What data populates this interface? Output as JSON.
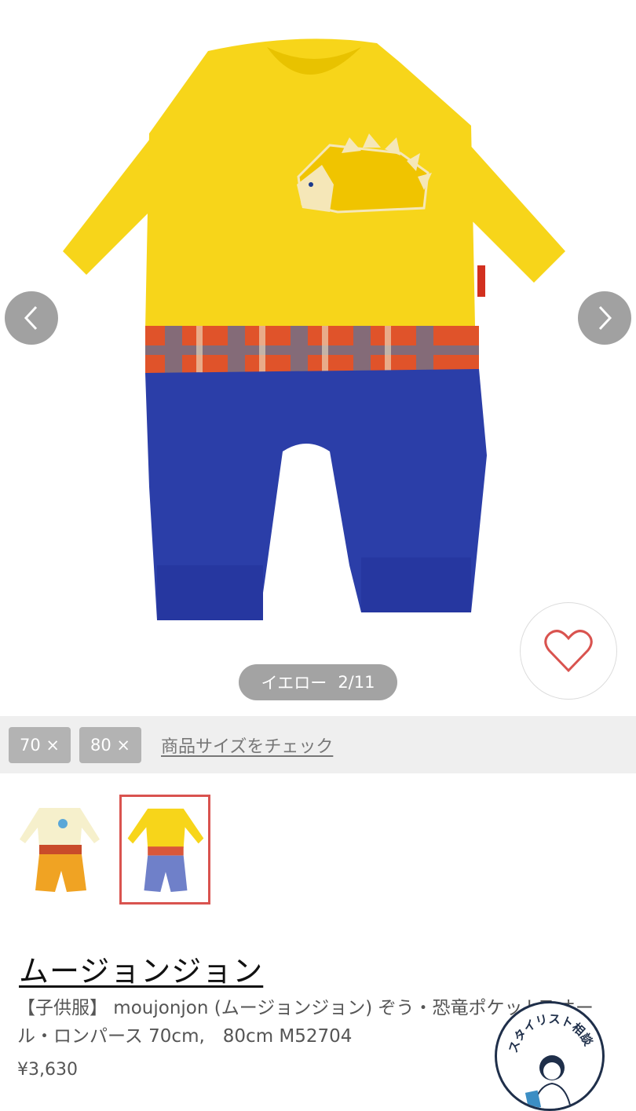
{
  "gallery": {
    "image_alt": "yellow dinosaur romper",
    "prev_icon": "chevron-left-icon",
    "next_icon": "chevron-right-icon",
    "color_label": "イエロー",
    "counter": "2/11",
    "favorite_icon": "heart-outline-icon"
  },
  "sizes": {
    "chips": [
      "70 ×",
      "80 ×"
    ],
    "check_link": "商品サイズをチェック"
  },
  "thumbnails": [
    {
      "name": "cream-orange-variant",
      "selected": false
    },
    {
      "name": "yellow-blue-variant",
      "selected": true
    }
  ],
  "product": {
    "brand": "ムージョンジョン",
    "title": "【子供服】 moujonjon (ムージョンジョン) ぞう・恐竜ポケットT オール・ロンパース 70cm,　80cm M52704",
    "price": "¥3,630"
  },
  "stylist_badge": {
    "label": "スタイリスト相談"
  },
  "colors": {
    "selected_border": "#d9534f",
    "arrow_bg": "#8c8c8c",
    "heart": "#d9534f",
    "size_chip_bg": "#b3b3b3",
    "badge_navy": "#1f2f4a"
  }
}
